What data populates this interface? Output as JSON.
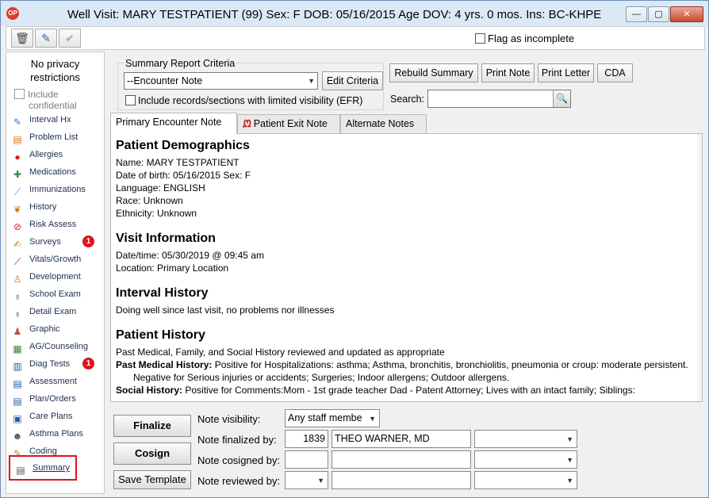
{
  "window": {
    "title": "Well Visit: MARY TESTPATIENT (99)  Sex: F  DOB: 05/16/2015  Age DOV: 4 yrs. 0 mos.  Ins: BC-KHPE",
    "app_icon_text": "OP",
    "minimize_glyph": "—",
    "maximize_glyph": "▢",
    "close_glyph": "✕"
  },
  "toolbar": {
    "delete_glyph": "🗑",
    "edit_glyph": "✎",
    "ok_glyph": "✔",
    "flag_label": "Flag as incomplete"
  },
  "sidebar": {
    "privacy_line1": "No privacy",
    "privacy_line2": "restrictions",
    "include_confidential_line1": "Include",
    "include_confidential_line2": "confidential",
    "items": [
      {
        "label": "Interval Hx",
        "icon": "interval-hx-icon",
        "glyph": "✎",
        "color": "#3a7bd5"
      },
      {
        "label": "Problem List",
        "icon": "problem-list-icon",
        "glyph": "▤",
        "color": "#d07a1b"
      },
      {
        "label": "Allergies",
        "icon": "allergies-icon",
        "glyph": "●",
        "color": "#d21c1c"
      },
      {
        "label": "Medications",
        "icon": "medications-icon",
        "glyph": "✚",
        "color": "#2f8a3b"
      },
      {
        "label": "Immunizations",
        "icon": "syringe-icon",
        "glyph": "⟋",
        "color": "#5a8fd0"
      },
      {
        "label": "History",
        "icon": "family-tree-icon",
        "glyph": "❦",
        "color": "#d07a1b"
      },
      {
        "label": "Risk Assess",
        "icon": "no-sign-icon",
        "glyph": "⊘",
        "color": "#d21c1c"
      },
      {
        "label": "Surveys",
        "icon": "survey-icon",
        "glyph": "✍",
        "color": "#c48a1a",
        "badge": "1"
      },
      {
        "label": "Vitals/Growth",
        "icon": "vitals-pen-icon",
        "glyph": "⟋",
        "color": "#b02020"
      },
      {
        "label": "Development",
        "icon": "development-icon",
        "glyph": "♙",
        "color": "#d07a1b"
      },
      {
        "label": "School Exam",
        "icon": "stethoscope-icon",
        "glyph": "♁",
        "color": "#333333"
      },
      {
        "label": "Detail Exam",
        "icon": "stethoscope-icon",
        "glyph": "♁",
        "color": "#333333"
      },
      {
        "label": "Graphic",
        "icon": "body-figure-icon",
        "glyph": "♟",
        "color": "#c0504d"
      },
      {
        "label": "AG/Counseling",
        "icon": "counseling-icon",
        "glyph": "▦",
        "color": "#2f8a3b"
      },
      {
        "label": "Diag Tests",
        "icon": "diag-tests-icon",
        "glyph": "▥",
        "color": "#1f5da8",
        "badge": "1"
      },
      {
        "label": "Assessment",
        "icon": "assessment-icon",
        "glyph": "▤",
        "color": "#1f5da8"
      },
      {
        "label": "Plan/Orders",
        "icon": "plan-orders-icon",
        "glyph": "▤",
        "color": "#1f5da8"
      },
      {
        "label": "Care Plans",
        "icon": "care-plans-icon",
        "glyph": "▣",
        "color": "#1f5da8"
      },
      {
        "label": "Asthma Plans",
        "icon": "asthma-icon",
        "glyph": "☻",
        "color": "#555555"
      },
      {
        "label": "Coding",
        "icon": "coding-icon",
        "glyph": "✎",
        "color": "#c48a1a"
      }
    ],
    "selected_item": {
      "label": "Summary",
      "icon": "summary-icon",
      "glyph": "▤",
      "color": "#555555"
    }
  },
  "criteria": {
    "legend": "Summary Report Criteria",
    "selected": "--Encounter Note",
    "edit_button": "Edit Criteria",
    "efr_label": "Include records/sections with limited visibility (EFR)"
  },
  "actions": {
    "rebuild": "Rebuild Summary",
    "print_note": "Print Note",
    "print_letter": "Print Letter",
    "cda": "CDA",
    "search_label": "Search:",
    "search_value": "",
    "search_icon": "🔍"
  },
  "tabs": [
    {
      "label": "Primary Encounter Note",
      "active": true
    },
    {
      "label": "Patient Exit Note",
      "icon_glyph": "ᘻ"
    },
    {
      "label": "Alternate Notes"
    }
  ],
  "note": {
    "demographics": {
      "heading": "Patient Demographics",
      "name": "Name: MARY TESTPATIENT",
      "dob": "Date of birth: 05/16/2015   Sex: F",
      "language": "Language: ENGLISH",
      "race": "Race: Unknown",
      "ethnicity": "Ethnicity: Unknown"
    },
    "visit": {
      "heading": "Visit Information",
      "datetime": "Date/time: 05/30/2019 @ 09:45 am",
      "location": "Location: Primary Location"
    },
    "interval": {
      "heading": "Interval History",
      "text": "Doing well since last visit, no problems nor illnesses"
    },
    "history": {
      "heading": "Patient History",
      "intro": "Past Medical, Family, and Social History reviewed and updated as appropriate",
      "pmh_label": "Past Medical History:",
      "pmh_text": " Positive for Hospitalizations: asthma; Asthma, bronchitis, bronchiolitis, pneumonia or croup: moderate persistent. Negative for Serious injuries or accidents; Surgeries; Indoor allergens; Outdoor allergens.",
      "social_label": "Social History:",
      "social_text": " Positive for Comments:Mom - 1st grade teacher  Dad - Patent Attorney; Lives with an intact family; Siblings:"
    }
  },
  "bottom": {
    "finalize": "Finalize",
    "cosign": "Cosign",
    "save_template": "Save Template",
    "visibility_label": "Note visibility:",
    "visibility_value": "Any staff membe",
    "finalized_label": "Note finalized by:",
    "finalized_id": "1839",
    "finalized_name": "THEO WARNER, MD",
    "cosigned_label": "Note cosigned by:",
    "reviewed_label": "Note reviewed by:",
    "chev": "▼"
  }
}
